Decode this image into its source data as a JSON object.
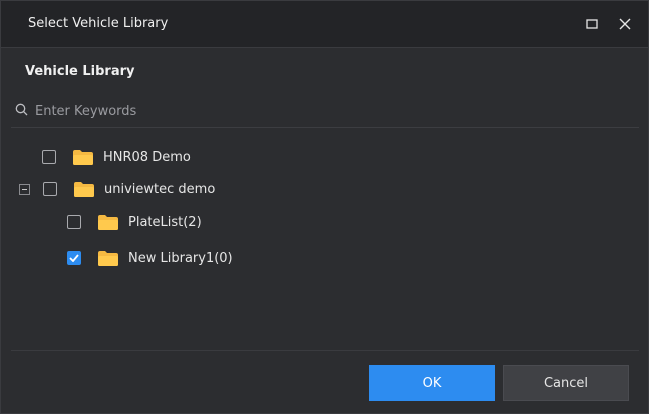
{
  "dialog": {
    "title": "Select Vehicle Library",
    "section_title": "Vehicle Library"
  },
  "search": {
    "placeholder": "Enter Keywords",
    "value": ""
  },
  "tree": {
    "items": [
      {
        "label": "HNR08 Demo",
        "checked": false,
        "level": 0,
        "expanded": null
      },
      {
        "label": "univiewtec demo",
        "checked": false,
        "level": 0,
        "expanded": true
      },
      {
        "label": "PlateList(2)",
        "checked": false,
        "level": 1,
        "expanded": null
      },
      {
        "label": "New Library1(0)",
        "checked": true,
        "level": 1,
        "expanded": null
      }
    ]
  },
  "buttons": {
    "ok": "OK",
    "cancel": "Cancel"
  },
  "colors": {
    "accent": "#2d8cf0",
    "folder": "#f5b942",
    "background": "#2c2d30",
    "titlebar": "#232427"
  },
  "icons": {
    "maximize": "maximize-icon",
    "close": "close-icon",
    "search": "search-icon",
    "folder": "folder-icon",
    "collapse": "minus-icon",
    "check": "check-icon"
  }
}
